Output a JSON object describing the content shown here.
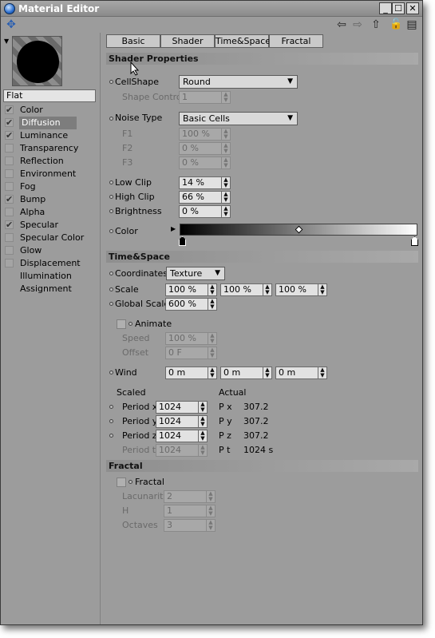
{
  "window": {
    "title": "Material Editor",
    "controls": [
      "_",
      "☐",
      "✕"
    ]
  },
  "toolbar": {
    "icons": [
      "pin-icon",
      "arrow-left-icon",
      "arrow-right-icon",
      "arrow-up-icon",
      "lock-icon",
      "panel-icon"
    ],
    "glyphs": {
      "pin": "✥",
      "left": "⇦",
      "right": "⇨",
      "up": "⇧",
      "lock": "🔓",
      "panel": "▤"
    }
  },
  "material": {
    "name": "Flat"
  },
  "channels": [
    {
      "label": "Color",
      "checked": true
    },
    {
      "label": "Diffusion",
      "checked": true
    },
    {
      "label": "Luminance",
      "checked": true
    },
    {
      "label": "Transparency",
      "checked": false
    },
    {
      "label": "Reflection",
      "checked": false
    },
    {
      "label": "Environment",
      "checked": false
    },
    {
      "label": "Fog",
      "checked": false
    },
    {
      "label": "Bump",
      "checked": true
    },
    {
      "label": "Alpha",
      "checked": false
    },
    {
      "label": "Specular",
      "checked": true
    },
    {
      "label": "Specular Color",
      "checked": false
    },
    {
      "label": "Glow",
      "checked": false
    },
    {
      "label": "Displacement",
      "checked": false
    },
    {
      "label": "Illumination",
      "checked": null
    },
    {
      "label": "Assignment",
      "checked": null
    }
  ],
  "check_glyph": "✔",
  "tabs": [
    "Basic",
    "Shader",
    "Time&Space",
    "Fractal"
  ],
  "shader": {
    "heading": "Shader Properties",
    "cellshape_label": "CellShape",
    "cellshape_value": "Round",
    "shape_control_label": "Shape Control",
    "shape_control_value": "1",
    "noise_type_label": "Noise Type",
    "noise_type_value": "Basic Cells",
    "f1_label": "F1",
    "f1_value": "100 %",
    "f2_label": "F2",
    "f2_value": "0 %",
    "f3_label": "F3",
    "f3_value": "0 %",
    "low_clip_label": "Low Clip",
    "low_clip_value": "14 %",
    "high_clip_label": "High Clip",
    "high_clip_value": "66 %",
    "brightness_label": "Brightness",
    "brightness_value": "0 %",
    "color_label": "Color"
  },
  "timespace": {
    "heading": "Time&Space",
    "coordinates_label": "Coordinates",
    "coordinates_value": "Texture",
    "scale_label": "Scale",
    "scale_values": [
      "100 %",
      "100 %",
      "100 %"
    ],
    "global_scale_label": "Global Scale",
    "global_scale_value": "600 %",
    "animate_label": "Animate",
    "speed_label": "Speed",
    "speed_value": "100 %",
    "offset_label": "Offset",
    "offset_value": "0 F",
    "wind_label": "Wind",
    "wind_values": [
      "0 m",
      "0 m",
      "0 m"
    ],
    "scaled_label": "Scaled",
    "actual_label": "Actual",
    "periods": [
      {
        "label": "Period x",
        "value": "1024",
        "actual_label": "P x",
        "actual_value": "307.2",
        "enabled": true
      },
      {
        "label": "Period y",
        "value": "1024",
        "actual_label": "P y",
        "actual_value": "307.2",
        "enabled": true
      },
      {
        "label": "Period z",
        "value": "1024",
        "actual_label": "P z",
        "actual_value": "307.2",
        "enabled": true
      },
      {
        "label": "Period t",
        "value": "1024",
        "actual_label": "P t",
        "actual_value": "1024 s",
        "enabled": false
      }
    ]
  },
  "fractal": {
    "heading": "Fractal",
    "fractal_label": "Fractal",
    "lacunarity_label": "Lacunarity",
    "lacunarity_value": "2",
    "h_label": "H",
    "h_value": "1",
    "octaves_label": "Octaves",
    "octaves_value": "3"
  },
  "colors": {
    "window_bg": "#9c9c9c",
    "selected_channel": "#7d7d7d",
    "field_bg": "#e2e2e2"
  }
}
